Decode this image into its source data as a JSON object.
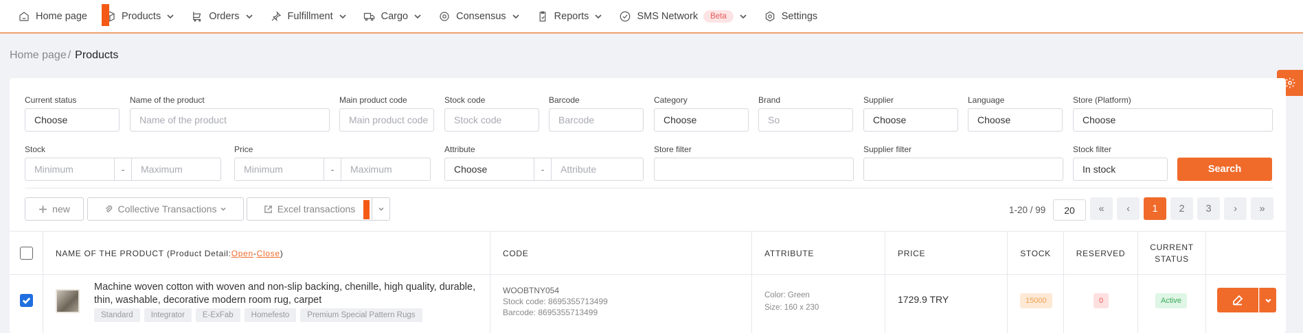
{
  "nav": {
    "home": "Home page",
    "products": "Products",
    "orders": "Orders",
    "fulfillment": "Fulfillment",
    "cargo": "Cargo",
    "consensus": "Consensus",
    "reports": "Reports",
    "sms": "SMS Network",
    "beta": "Beta",
    "settings": "Settings"
  },
  "breadcrumb": {
    "home": "Home page",
    "sep": "/",
    "current": "Products"
  },
  "filters": {
    "status_label": "Current status",
    "status_value": "Choose",
    "name_label": "Name of the product",
    "name_ph": "Name of the product",
    "main_code_label": "Main product code",
    "main_code_ph": "Main product code",
    "stock_code_label": "Stock code",
    "stock_code_ph": "Stock code",
    "barcode_label": "Barcode",
    "barcode_ph": "Barcode",
    "category_label": "Category",
    "category_value": "Choose",
    "brand_label": "Brand",
    "brand_ph": "So",
    "supplier_label": "Supplier",
    "supplier_value": "Choose",
    "language_label": "Language",
    "language_value": "Choose",
    "store_label": "Store (Platform)",
    "store_value": "Choose",
    "stock_label": "Stock",
    "stock_min_ph": "Minimum",
    "stock_max_ph": "Maximum",
    "price_label": "Price",
    "price_min_ph": "Minimum",
    "price_max_ph": "Maximum",
    "attribute_label": "Attribute",
    "attribute_value": "Choose",
    "attribute_ph": "Attribute",
    "dash": "-",
    "store_filter_label": "Store filter",
    "supplier_filter_label": "Supplier filter",
    "stock_filter_label": "Stock filter",
    "stock_filter_value": "In stock",
    "search_button": "Search"
  },
  "toolbar": {
    "new": "new",
    "collective": "Collective Transactions",
    "excel": "Excel transactions"
  },
  "pagination": {
    "info": "1-20 / 99",
    "page_size": "20",
    "first": "«",
    "prev": "‹",
    "p1": "1",
    "p2": "2",
    "p3": "3",
    "next": "›",
    "last": "»"
  },
  "table": {
    "col_name": "NAME OF THE PRODUCT",
    "detail_prefix": "(Product Detail: ",
    "detail_open": "Open",
    "detail_sep": " - ",
    "detail_close": "Close",
    "detail_suffix": ")",
    "col_code": "CODE",
    "col_attribute": "ATTRIBUTE",
    "col_price": "PRICE",
    "col_stock": "STOCK",
    "col_reserved": "RESERVED",
    "col_status": "CURRENT STATUS"
  },
  "rows": [
    {
      "checked": true,
      "name": "Machine woven cotton with woven and non-slip backing, chenille, high quality, durable, thin, washable, decorative modern room rug, carpet",
      "tags": [
        "Standard",
        "Integrator",
        "E-ExFab",
        "Homefesto",
        "Premium Special Pattern Rugs"
      ],
      "code": "WOOBTNY054",
      "stock_code": "Stock code: 8695355713499",
      "barcode": "Barcode: 8695355713499",
      "color": "Color: Green",
      "size": "Size: 160 x 230",
      "price": "1729.9 TRY",
      "stock": "15000",
      "reserved": "0",
      "status": "Active"
    }
  ],
  "colors": {
    "accent": "#f06a2a",
    "marker": "#f45a16",
    "checkbox": "#1f6fe0"
  }
}
